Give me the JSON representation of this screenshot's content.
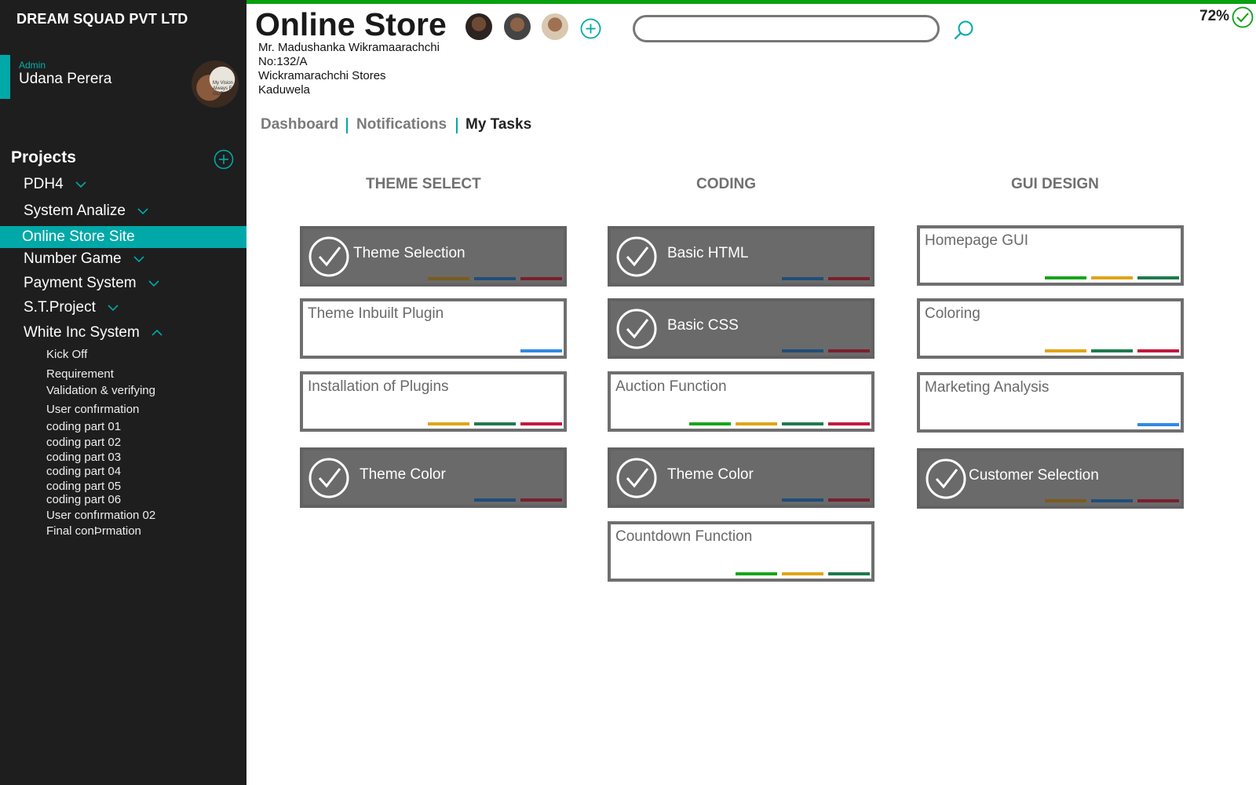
{
  "sidebar": {
    "company": "DREAM SQUAD PVT LTD",
    "user": {
      "role": "Admin",
      "name": "Udana Perera",
      "avatar_text": "My Vision Always Fl... GOD"
    },
    "projects_title": "Projects",
    "projects": [
      {
        "label": "PDH4",
        "expanded": false
      },
      {
        "label": "System Analize",
        "expanded": false
      },
      {
        "label": "Online Store Site",
        "active": true
      },
      {
        "label": "Number Game",
        "expanded": false
      },
      {
        "label": "Payment System",
        "expanded": false
      },
      {
        "label": "S.T.Project",
        "expanded": false
      },
      {
        "label": "White Inc System",
        "expanded": true
      }
    ],
    "subitems": [
      "Kick Off",
      "Requirement",
      "Validation & verifying",
      "User confırmation",
      "coding part 01",
      "coding part 02",
      "coding part 03",
      "coding part 04",
      "coding part 05",
      "coding part 06",
      "User confırmation 02",
      "Final conÞrmation"
    ]
  },
  "header": {
    "title": "Online Store",
    "address": [
      "Mr. Madushanka Wikramaarachchi",
      "No:132/A",
      "Wickramarachchi Stores",
      "Kaduwela"
    ],
    "search": {
      "value": "",
      "placeholder": ""
    },
    "completion": "72%",
    "progress_color": "#07a10f"
  },
  "tabs": [
    {
      "label": "Dashboard",
      "active": false
    },
    {
      "label": "Notifications",
      "active": false
    },
    {
      "label": "My Tasks",
      "active": true
    }
  ],
  "colors": {
    "brown": "#7a5c1a",
    "navy": "#1f4e79",
    "maroon": "#7a1f2e",
    "blue": "#2f8ae5",
    "amber": "#e0a418",
    "green": "#1e7a4d",
    "crimson": "#c4183f",
    "lime": "#16a51a",
    "accent": "#00a9a8"
  },
  "board": {
    "columns": [
      {
        "title": "THEME SELECT",
        "cards": [
          {
            "title": "Theme Selection",
            "done": true,
            "tags": [
              "brown",
              "navy",
              "maroon"
            ]
          },
          {
            "title": "Theme Inbuilt Plugin",
            "done": false,
            "tags": [
              "blue"
            ]
          },
          {
            "title": "Installation of Plugins",
            "done": false,
            "tags": [
              "amber",
              "green",
              "crimson"
            ]
          },
          {
            "title": "Theme Color",
            "done": true,
            "tags": [
              "navy",
              "maroon"
            ]
          }
        ]
      },
      {
        "title": "CODING",
        "cards": [
          {
            "title": "Basic HTML",
            "done": true,
            "tags": [
              "navy",
              "maroon"
            ]
          },
          {
            "title": "Basic CSS",
            "done": true,
            "tags": [
              "navy",
              "maroon"
            ]
          },
          {
            "title": "Auction Function",
            "done": false,
            "tags": [
              "lime",
              "amber",
              "green",
              "crimson"
            ]
          },
          {
            "title": "Theme Color",
            "done": true,
            "tags": [
              "navy",
              "maroon"
            ]
          },
          {
            "title": "Countdown Function",
            "done": false,
            "tags": [
              "lime",
              "amber",
              "green"
            ]
          }
        ]
      },
      {
        "title": "GUI DESIGN",
        "cards": [
          {
            "title": "Homepage GUI",
            "done": false,
            "tags": [
              "lime",
              "amber",
              "green"
            ]
          },
          {
            "title": "Coloring",
            "done": false,
            "tags": [
              "amber",
              "green",
              "crimson"
            ]
          },
          {
            "title": "Marketing Analysis",
            "done": false,
            "tags": [
              "blue"
            ]
          },
          {
            "title": "Customer Selection",
            "done": true,
            "tags": [
              "brown",
              "navy",
              "maroon"
            ]
          }
        ]
      }
    ]
  }
}
